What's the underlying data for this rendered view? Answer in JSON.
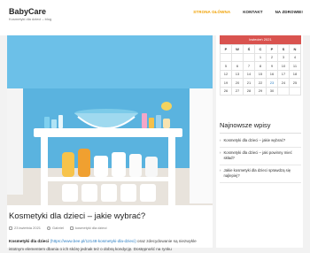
{
  "site": {
    "title": "BabyCare",
    "tagline": "Kosmetyki dla dzieci – blog"
  },
  "nav": [
    {
      "label": "STRONA GŁÓWNA",
      "active": true
    },
    {
      "label": "KONTAKT",
      "active": false
    },
    {
      "label": "NA ZDROWIE!",
      "active": false
    }
  ],
  "post": {
    "title": "Kosmetyki dla dzieci – jakie wybrać?",
    "date": "23 kwietnia 2021",
    "author": "Gabriel",
    "category": "kosmetyki dla dzieci",
    "excerpt_bold": "Kosmetyki dla dzieci",
    "excerpt_link": "(https://www.bee.pl/12148-kosmetyki-dla-dzieci)",
    "excerpt_rest": " oraz zdecydowanie są niezwykle",
    "excerpt_line2": "istotnym elementem dbania o ich skórę jednak też o dobrą kondycję. Dostępność na rynku"
  },
  "calendar": {
    "month": "kwiecień 2021",
    "weekdays": [
      "P",
      "W",
      "Ś",
      "C",
      "P",
      "S",
      "N"
    ],
    "weeks": [
      [
        "",
        "",
        "",
        "1",
        "2",
        "3",
        "4"
      ],
      [
        "5",
        "6",
        "7",
        "8",
        "9",
        "10",
        "11"
      ],
      [
        "12",
        "13",
        "14",
        "15",
        "16",
        "17",
        "18"
      ],
      [
        "19",
        "20",
        "21",
        "22",
        "23",
        "24",
        "25"
      ],
      [
        "26",
        "27",
        "28",
        "29",
        "30",
        "",
        ""
      ]
    ]
  },
  "recent": {
    "title": "Najnowsze wpisy",
    "items": [
      "Kosmetyki dla dzieci – jakie wybrać?",
      "Kosmetyki dla dzieci – jaki powinny mieć skład?",
      "Jakie kosmetyki dla dzieci sprawdzą się najlepiej?"
    ]
  }
}
